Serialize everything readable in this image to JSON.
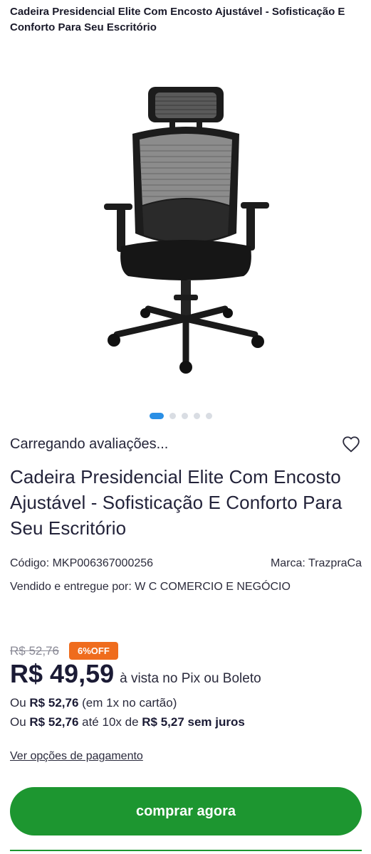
{
  "header": {
    "title": "Cadeira Presidencial Elite Com Encosto Ajustável - Sofisticação E Conforto Para Seu Escritório"
  },
  "gallery": {
    "image_icon": "office-chair-illustration",
    "dot_count": 5,
    "active_index": 0
  },
  "reviews": {
    "loading_text": "Carregando avaliações...",
    "favorite_icon": "heart-outline-icon"
  },
  "product": {
    "name": "Cadeira Presidencial Elite Com Encosto Ajustável - Sofisticação E Conforto Para Seu Escritório",
    "code_label": "Código: MKP006367000256",
    "brand_label": "Marca: TrazpraCa",
    "seller_label": "Vendido e entregue por: W C COMERCIO E NEGÓCIO"
  },
  "pricing": {
    "old_price": "R$ 52,76",
    "discount_badge": "6%OFF",
    "price": "R$ 49,59",
    "price_suffix": "à vista no Pix ou Boleto",
    "card_line": {
      "prefix": "Ou ",
      "amount": "R$ 52,76",
      "suffix": " (em 1x no cartão)"
    },
    "installment_line": {
      "prefix": "Ou ",
      "amount": "R$ 52,76",
      "middle": " até 10x de ",
      "installment_amount": "R$ 5,27",
      "suffix": " sem juros"
    },
    "payment_options_link": "Ver opções de pagamento"
  },
  "actions": {
    "buy_now_label": "comprar agora"
  },
  "colors": {
    "accent_green": "#1d9630",
    "discount_orange": "#ef6c1d",
    "dot_active": "#2a8fe5"
  }
}
